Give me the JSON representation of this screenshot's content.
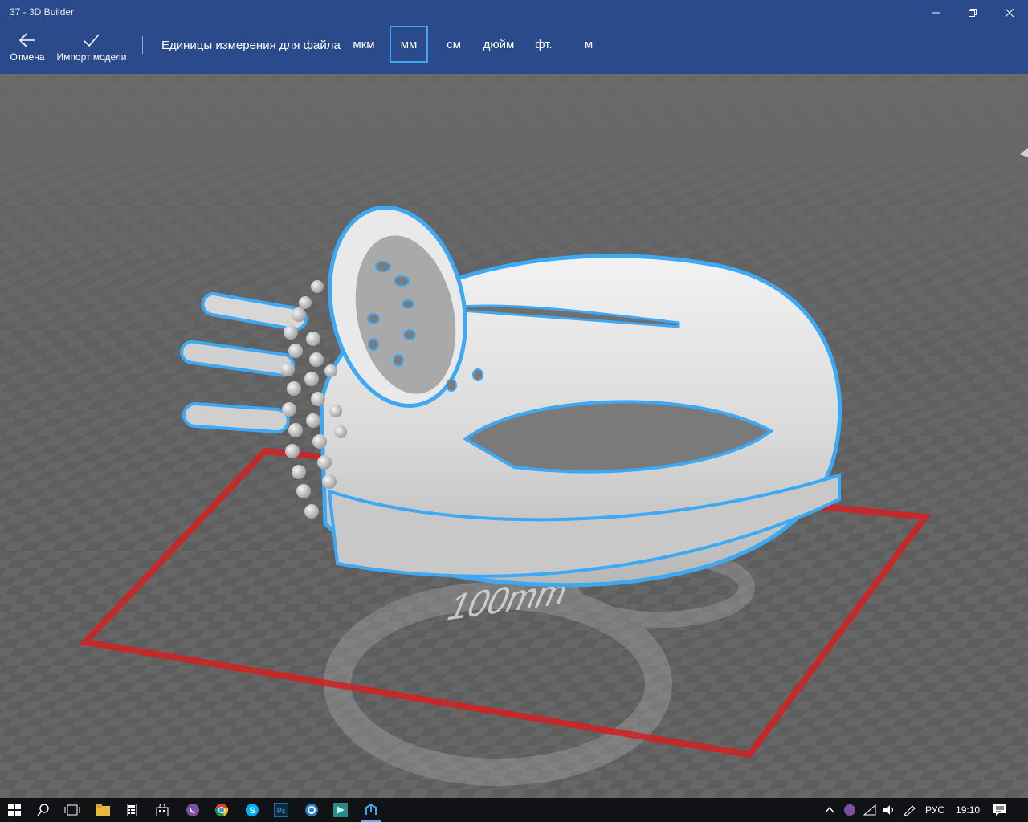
{
  "window": {
    "title": "37 - 3D Builder"
  },
  "commands": {
    "cancel_label": "Отмена",
    "import_label": "Импорт модели"
  },
  "units": {
    "label": "Единицы измерения для файла",
    "options": [
      "мкм",
      "мм",
      "см",
      "дюйм",
      "фт.",
      "м"
    ],
    "selected": "мм"
  },
  "viewport": {
    "plate_label": "100mm"
  },
  "taskbar": {
    "apps": [
      "start",
      "search",
      "task-view",
      "file-explorer",
      "calculator",
      "store",
      "viber",
      "chrome",
      "skype",
      "photoshop",
      "app-circle",
      "app-green",
      "3d-builder"
    ],
    "tray": {
      "language": "РУС",
      "time": "19:10"
    }
  },
  "colors": {
    "accent": "#3da9f5",
    "appbar": "#2b4a8b",
    "plate_border": "#d42020"
  }
}
